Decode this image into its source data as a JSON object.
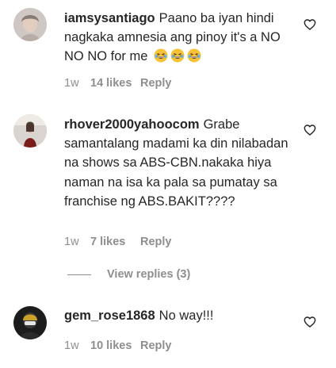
{
  "comments": [
    {
      "username": "iamsysantiago",
      "text": "Paano ba iyan hindi nagkaka amnesia ang pinoy it's a NO NO NO for me",
      "emojis": [
        "grinning-squinting-face",
        "grinning-squinting-face",
        "grinning-squinting-face"
      ],
      "time": "1w",
      "likes": "14 likes",
      "reply": "Reply"
    },
    {
      "username": "rhover2000yahoocom",
      "text": "Grabe samantalang madami ka din nilabadan na shows sa ABS-CBN.nakaka hiya naman na isa ka pala sa pumatay sa franchise ng ABS.BAKIT????",
      "time": "1w",
      "likes": "7 likes",
      "reply": "Reply",
      "view_replies": "View replies (3)"
    },
    {
      "username": "gem_rose1868",
      "text": "No way!!!",
      "time": "1w",
      "likes": "10 likes",
      "reply": "Reply"
    }
  ],
  "icons": {
    "like": "heart-outline-icon"
  }
}
